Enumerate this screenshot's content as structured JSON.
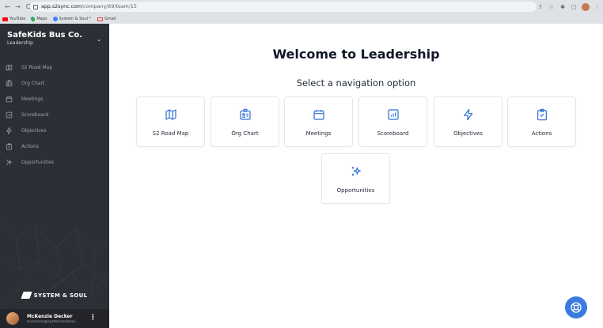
{
  "browser": {
    "url_host": "app.s2sync.com",
    "url_path": "/company/69/team/15",
    "bookmarks": [
      {
        "label": "YouTube",
        "icon": "youtube-icon"
      },
      {
        "label": "Maps",
        "icon": "maps-icon"
      },
      {
        "label": "System & Soul™",
        "icon": "system-soul-icon"
      },
      {
        "label": "Gmail",
        "icon": "gmail-icon"
      }
    ]
  },
  "sidebar": {
    "company_name": "SafeKids Bus Co.",
    "company_sub": "Leadership",
    "items": [
      {
        "label": "S2 Road Map",
        "icon": "map-icon"
      },
      {
        "label": "Org Chart",
        "icon": "org-chart-icon"
      },
      {
        "label": "Meetings",
        "icon": "calendar-icon"
      },
      {
        "label": "Scoreboard",
        "icon": "chart-icon"
      },
      {
        "label": "Objectives",
        "icon": "bolt-icon"
      },
      {
        "label": "Actions",
        "icon": "clipboard-check-icon"
      },
      {
        "label": "Opportunities",
        "icon": "sparkles-icon"
      }
    ],
    "brand": "SYSTEM & SOUL",
    "user_name": "McKenzie Decker",
    "user_email": "mckenzie@systemandsoul..."
  },
  "main": {
    "title": "Welcome to Leadership",
    "subtitle": "Select a navigation option",
    "cards": [
      {
        "label": "S2 Road Map",
        "icon": "map-icon"
      },
      {
        "label": "Org Chart",
        "icon": "org-chart-icon"
      },
      {
        "label": "Meetings",
        "icon": "calendar-icon"
      },
      {
        "label": "Scoreboard",
        "icon": "chart-icon"
      },
      {
        "label": "Objectives",
        "icon": "bolt-icon"
      },
      {
        "label": "Actions",
        "icon": "clipboard-check-icon"
      },
      {
        "label": "Opportunities",
        "icon": "sparkles-icon"
      }
    ]
  },
  "colors": {
    "sidebar_bg": "#2d2f36",
    "accent": "#3b7be0",
    "icon_blue": "#2f6fd6"
  }
}
